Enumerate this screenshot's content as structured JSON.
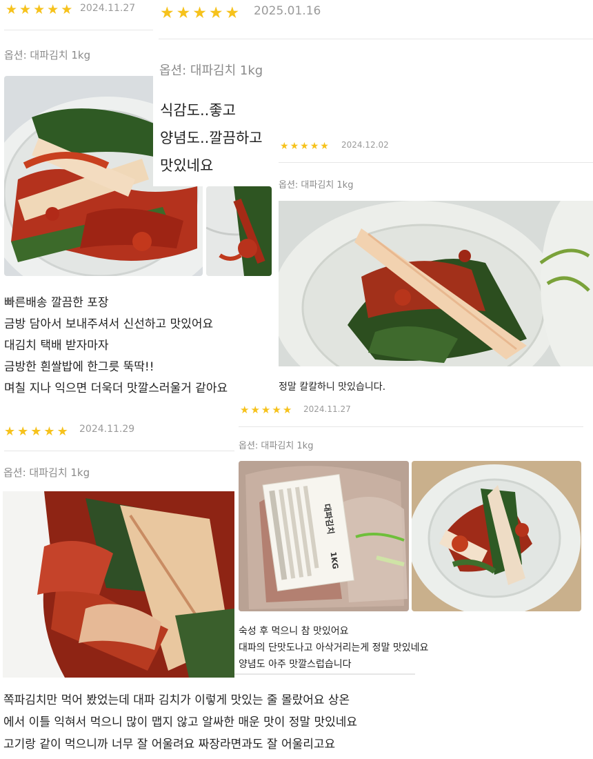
{
  "reviews": [
    {
      "stars": 5,
      "date": "2024.11.27",
      "option": "옵션: 대파김치 1kg",
      "body": [
        "빠른배송 깔끔한 포장",
        "금방 담아서 보내주셔서 신선하고 맛있어요",
        "대김치 택배 받자마자",
        "금방한 흰쌀밥에 한그릇 뚝딱!!",
        "며칠 지나 익으면 더욱더 맛깔스러울거 같아요"
      ]
    },
    {
      "stars": 5,
      "date": "2025.01.16",
      "option": "옵션: 대파김치 1kg",
      "body": [
        "식감도..좋고",
        "양념도..깔끔하고",
        "맛있네요"
      ]
    },
    {
      "stars": 5,
      "date": "2024.12.02",
      "option": "옵션: 대파김치 1kg",
      "body": [
        "정말 칼칼하니 맛있습니다."
      ]
    },
    {
      "stars": 5,
      "date": "2024.11.29",
      "option": "옵션: 대파김치 1kg",
      "body": [
        "쪽파김치만 먹어 봤었는데 대파 김치가 이렇게 맛있는 줄 몰랐어요 상온",
        "에서 이틀 익혀서 먹으니 많이 맵지 않고 알싸한 매운 맛이 정말 맛있네요",
        "고기랑 같이 먹으니까 너무 잘 어울려요 짜장라면과도 잘 어울리고요"
      ]
    },
    {
      "stars": 5,
      "date": "2024.11.27",
      "option": "옵션: 대파김치 1kg",
      "body": [
        "숙성 후 먹으니 참 맛있어요",
        "대파의 단맛도나고 아삭거리는게 정말 맛있네요",
        "양념도 아주 맛깔스럽습니다"
      ]
    }
  ],
  "package_label": {
    "name": "대파김치",
    "weight": "1KG"
  },
  "colors": {
    "star": "#f6c21c",
    "date": "#9a9a9a",
    "option": "#8a8a8a"
  }
}
